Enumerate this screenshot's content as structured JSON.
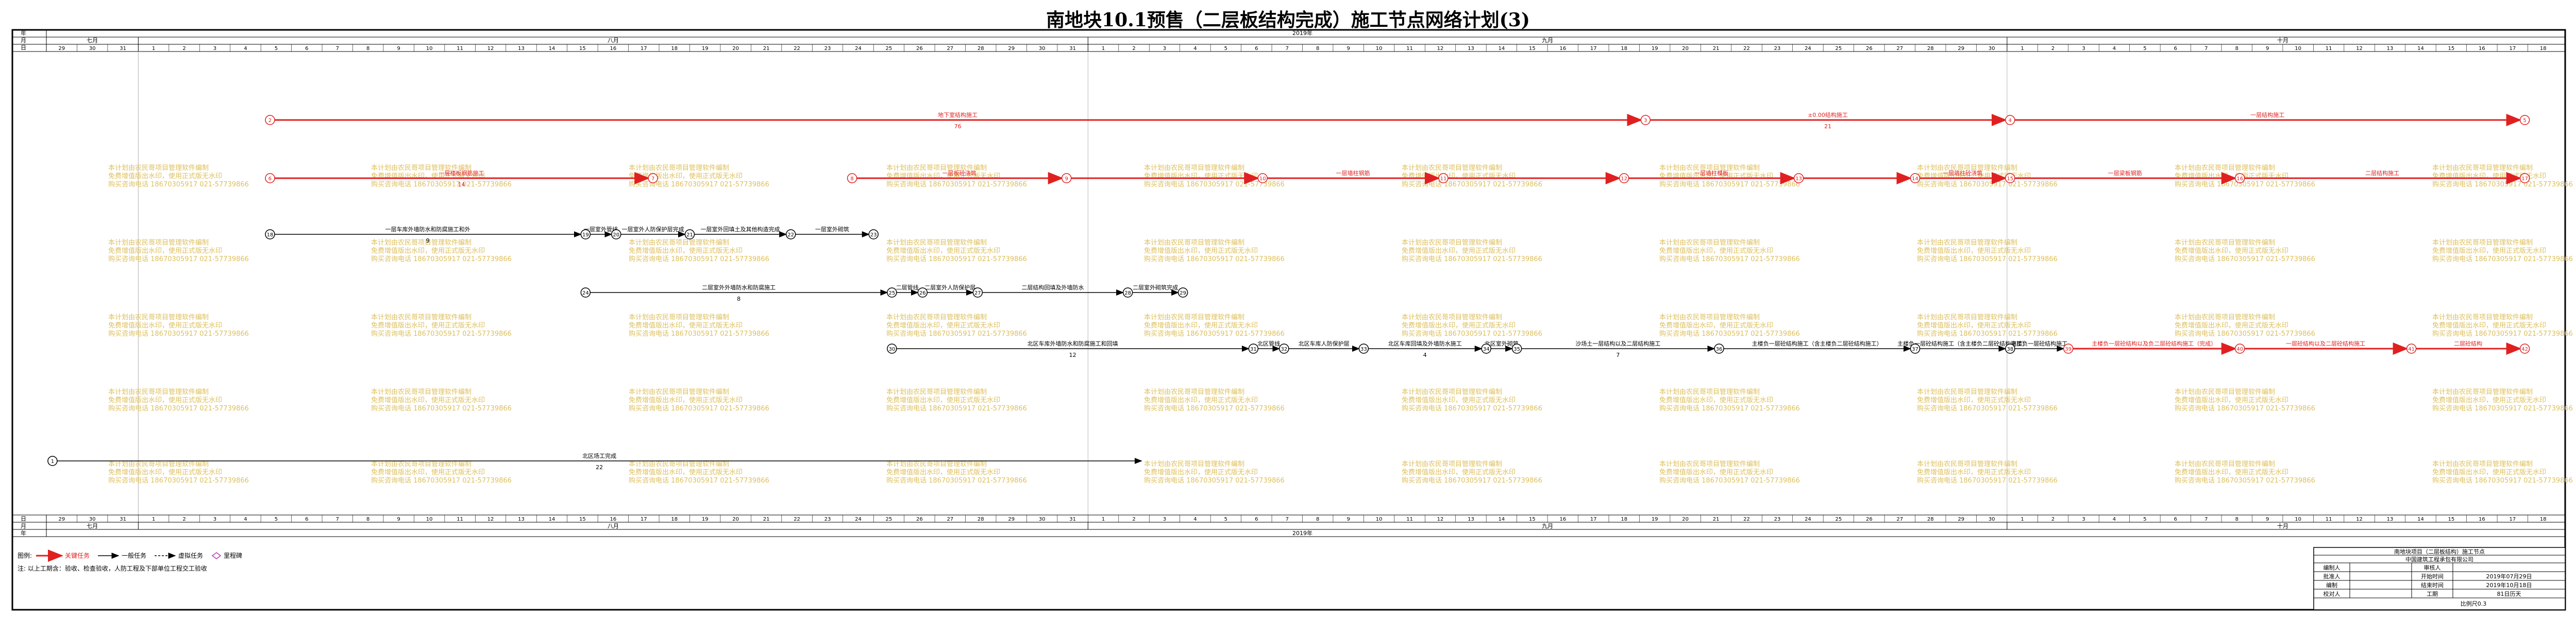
{
  "title": "南地块10.1预售（二层板结构完成）施工节点网络计划(3)",
  "header": {
    "row_labels": {
      "year": "年",
      "month": "月",
      "day": "日"
    },
    "year": "2019年",
    "months": [
      "七月",
      "八月",
      "九月",
      "十月"
    ],
    "days": [
      "29",
      "30",
      "31",
      "1",
      "2",
      "3",
      "4",
      "5",
      "6",
      "7",
      "8",
      "9",
      "10",
      "11",
      "12",
      "13",
      "14",
      "15",
      "16",
      "17",
      "18",
      "19",
      "20",
      "21",
      "22",
      "23",
      "24",
      "25",
      "26",
      "27",
      "28",
      "29",
      "30",
      "31",
      "1",
      "2",
      "3",
      "4",
      "5",
      "6",
      "7",
      "8",
      "9",
      "10",
      "11",
      "12",
      "13",
      "14",
      "15",
      "16",
      "17",
      "18",
      "19",
      "20",
      "21",
      "22",
      "23",
      "24",
      "25",
      "26",
      "27",
      "28",
      "29",
      "30",
      "1",
      "2",
      "3",
      "4",
      "5",
      "6",
      "7",
      "8",
      "9",
      "10",
      "11",
      "12",
      "13",
      "14",
      "15",
      "16",
      "17",
      "18"
    ]
  },
  "footer": {
    "row_labels": {
      "day": "日",
      "month": "月",
      "year": "年"
    },
    "months": [
      "七月",
      "八月",
      "九月",
      "十月"
    ],
    "year": "2019年"
  },
  "watermark": {
    "lines": [
      "本计划由农民哥项目管理软件编制",
      "免费增值版出水印，使用正式版无水印",
      "购买咨询电话 18670305917 021-57739866"
    ]
  },
  "network": {
    "nodes": [
      {
        "id": "n1",
        "label": "1"
      },
      {
        "id": "n2",
        "label": "2"
      },
      {
        "id": "n3",
        "label": "3"
      },
      {
        "id": "n4",
        "label": "4"
      },
      {
        "id": "n5",
        "label": "5"
      },
      {
        "id": "n6",
        "label": "6"
      },
      {
        "id": "n7",
        "label": "7"
      },
      {
        "id": "n8",
        "label": "8"
      },
      {
        "id": "n9",
        "label": "9"
      },
      {
        "id": "n10",
        "label": "10"
      },
      {
        "id": "n11",
        "label": "11"
      },
      {
        "id": "n12",
        "label": "12"
      },
      {
        "id": "n13",
        "label": "13"
      },
      {
        "id": "n14",
        "label": "14"
      },
      {
        "id": "n15",
        "label": "15"
      },
      {
        "id": "n16",
        "label": "16"
      },
      {
        "id": "n17",
        "label": "17"
      },
      {
        "id": "n18",
        "label": "18"
      },
      {
        "id": "n19",
        "label": "19"
      },
      {
        "id": "n20",
        "label": "20"
      },
      {
        "id": "n21",
        "label": "21"
      },
      {
        "id": "n22",
        "label": "22"
      },
      {
        "id": "n23",
        "label": "23"
      },
      {
        "id": "n24",
        "label": "24"
      },
      {
        "id": "n25",
        "label": "25"
      },
      {
        "id": "n26",
        "label": "26"
      },
      {
        "id": "n27",
        "label": "27"
      },
      {
        "id": "n28",
        "label": "28"
      },
      {
        "id": "n29",
        "label": "29"
      },
      {
        "id": "n30",
        "label": "30"
      },
      {
        "id": "n31",
        "label": "31"
      },
      {
        "id": "n32",
        "label": "32"
      },
      {
        "id": "n33",
        "label": "33"
      },
      {
        "id": "n34",
        "label": "34"
      },
      {
        "id": "n35",
        "label": "35"
      },
      {
        "id": "n36",
        "label": "36"
      },
      {
        "id": "n37",
        "label": "37"
      },
      {
        "id": "n38",
        "label": "38"
      },
      {
        "id": "n39",
        "label": "39"
      },
      {
        "id": "n40",
        "label": "40"
      },
      {
        "id": "n41",
        "label": "41"
      },
      {
        "id": "n42",
        "label": "42"
      }
    ],
    "tasks": [
      {
        "from": "n2",
        "to": "n3",
        "name": "地下室结构施工",
        "duration": "76",
        "critical": true
      },
      {
        "from": "n3",
        "to": "n4",
        "name": "±0.00结构施工",
        "duration": "21",
        "critical": true
      },
      {
        "from": "n4",
        "to": "n5",
        "name": "一层结构施工",
        "duration": "",
        "critical": true
      },
      {
        "from": "n6",
        "to": "n7",
        "name": "一层楼板钢筋施工",
        "duration": "14",
        "critical": true
      },
      {
        "from": "n8",
        "to": "n9",
        "name": "一层板砼浇筑",
        "duration": "",
        "critical": true
      },
      {
        "from": "n9",
        "to": "n10",
        "name": "",
        "duration": "",
        "critical": true
      },
      {
        "from": "n10",
        "to": "n11",
        "name": "一层墙柱钢筋",
        "duration": "",
        "critical": true
      },
      {
        "from": "n11",
        "to": "n12",
        "name": "",
        "duration": "",
        "critical": true
      },
      {
        "from": "n12",
        "to": "n13",
        "name": "一层墙柱模板",
        "duration": "",
        "critical": true
      },
      {
        "from": "n13",
        "to": "n14",
        "name": "",
        "duration": "",
        "critical": true
      },
      {
        "from": "n14",
        "to": "n15",
        "name": "一层墙柱砼浇筑",
        "duration": "",
        "critical": true
      },
      {
        "from": "n15",
        "to": "n16",
        "name": "一层梁板钢筋",
        "duration": "",
        "critical": true
      },
      {
        "from": "n16",
        "to": "n17",
        "name": "二层结构施工",
        "duration": "",
        "critical": true
      },
      {
        "from": "n18",
        "to": "n19",
        "name": "一层车库外墙防水和防腐施工和外",
        "duration": "9",
        "critical": false
      },
      {
        "from": "n19",
        "to": "n20",
        "name": "一层室外管线",
        "duration": "",
        "critical": false
      },
      {
        "from": "n20",
        "to": "n21",
        "name": "一层室外人防保护层完成",
        "duration": "",
        "critical": false
      },
      {
        "from": "n21",
        "to": "n22",
        "name": "一层室外回填土及其他构造完成",
        "duration": "",
        "critical": false
      },
      {
        "from": "n22",
        "to": "n23",
        "name": "一层室外砌筑",
        "duration": "",
        "critical": false
      },
      {
        "from": "n24",
        "to": "n25",
        "name": "二层室外外墙防水和防腐施工",
        "duration": "8",
        "critical": false
      },
      {
        "from": "n25",
        "to": "n26",
        "name": "二层管线",
        "duration": "",
        "critical": false
      },
      {
        "from": "n26",
        "to": "n27",
        "name": "二层室外人防保护层",
        "duration": "",
        "critical": false
      },
      {
        "from": "n27",
        "to": "n28",
        "name": "二层结构回填及外墙防水",
        "duration": "",
        "critical": false
      },
      {
        "from": "n28",
        "to": "n29",
        "name": "二层室外砌筑完成",
        "duration": "",
        "critical": false
      },
      {
        "from": "n30",
        "to": "n31",
        "name": "北区车库外墙防水和防腐施工和回填",
        "duration": "12",
        "critical": false
      },
      {
        "from": "n31",
        "to": "n32",
        "name": "北区管线",
        "duration": "",
        "critical": false
      },
      {
        "from": "n32",
        "to": "n33",
        "name": "北区车库人防保护层",
        "duration": "",
        "critical": false
      },
      {
        "from": "n33",
        "to": "n34",
        "name": "北区车库回填及外墙防水施工",
        "duration": "4",
        "critical": false
      },
      {
        "from": "n34",
        "to": "n35",
        "name": "北区室外砌筑",
        "duration": "",
        "critical": false
      },
      {
        "from": "n35",
        "to": "n36",
        "name": "沙场土一层结构以及二层结构施工",
        "duration": "7",
        "critical": false
      },
      {
        "from": "n36",
        "to": "n37",
        "name": "主楼负一层砼结构施工（含主楼负二层砼结构施工）",
        "duration": "",
        "critical": false
      },
      {
        "from": "n37",
        "to": "n38",
        "name": "主楼负一层砼结构施工（含主楼负二层砼结构施工）",
        "duration": "",
        "critical": false
      },
      {
        "from": "n38",
        "to": "n39",
        "name": "主楼负一层砼结构施工",
        "duration": "",
        "critical": false
      },
      {
        "from": "n39",
        "to": "n40",
        "name": "主楼负一层砼结构以及负二层砼结构施工（完成）",
        "duration": "",
        "critical": true
      },
      {
        "from": "n40",
        "to": "n41",
        "name": "一层砼结构以及二层砼结构施工",
        "duration": "",
        "critical": true
      },
      {
        "from": "n41",
        "to": "n42",
        "name": "二层砼结构",
        "duration": "",
        "critical": true
      },
      {
        "from": "n1",
        "to": "n29",
        "name": "北区场工完成",
        "duration": "22",
        "critical": false
      }
    ]
  },
  "legend": {
    "label": "图例:",
    "items": [
      {
        "kind": "critical",
        "text": "关键任务"
      },
      {
        "kind": "normal",
        "text": "一般任务"
      },
      {
        "kind": "dummy",
        "text": "虚拟任务"
      },
      {
        "kind": "milestone",
        "text": "里程碑"
      }
    ],
    "note": "注: 以上工期含：验收、检查验收，人防工程及下部单位工程交工验收"
  },
  "title_block": {
    "project": "南地块项目（二层板结构）施工节点",
    "subtitle": "中国建筑工程承包有限公司",
    "rows": [
      [
        "编制人",
        "",
        "审核人",
        ""
      ],
      [
        "批准人",
        "",
        "开始时间",
        "2019年07月29日"
      ],
      [
        "编制",
        "",
        "结束时间",
        "2019年10月18日"
      ],
      [
        "校对人",
        "",
        "工期",
        "81日历天"
      ]
    ],
    "scale": "比例尺0.3"
  },
  "colors": {
    "critical": "#e02020",
    "normal": "#000000",
    "watermark": "#d9b84a",
    "grid": "#333333"
  }
}
